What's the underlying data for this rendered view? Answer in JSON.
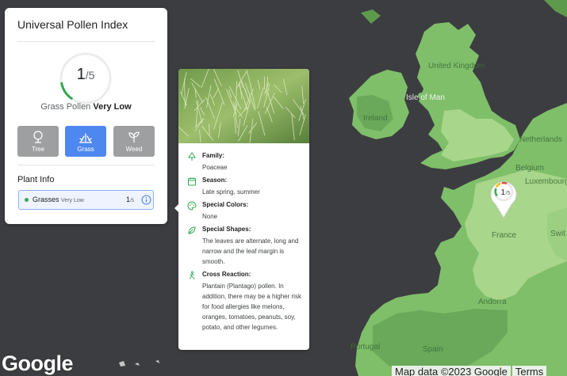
{
  "panel": {
    "title": "Universal Pollen Index",
    "index_value": "1",
    "index_denominator": "/5",
    "index_fraction": 0.2,
    "pollen_type_label": "Grass Pollen",
    "pollen_level": "Very Low",
    "type_buttons": [
      {
        "label": "Tree",
        "icon": "tree-icon",
        "active": false
      },
      {
        "label": "Grass",
        "icon": "grass-icon",
        "active": true
      },
      {
        "label": "Weed",
        "icon": "weed-icon",
        "active": false
      }
    ],
    "plant_info_title": "Plant Info",
    "plant_row": {
      "name": "Grasses",
      "level": "Very Low",
      "value": "1",
      "denominator": "/5",
      "status_color": "#34a853"
    }
  },
  "card": {
    "facts": [
      {
        "title": "Family:",
        "text": "Poaceae",
        "icon": "tree-outline-icon"
      },
      {
        "title": "Season:",
        "text": "Late spring, summer",
        "icon": "calendar-icon"
      },
      {
        "title": "Special Colors:",
        "text": "None",
        "icon": "palette-icon"
      },
      {
        "title": "Special Shapes:",
        "text": "The leaves are alternate, long and narrow and the leaf margin is smooth.",
        "icon": "leaf-icon"
      },
      {
        "title": "Cross Reaction:",
        "text": "Plantain (Plantago) pollen. In addition, there may be a higher risk for food allergies like melons, oranges, tomatoes, peanuts, soy, potato, and other legumes.",
        "icon": "cross-reaction-icon"
      }
    ]
  },
  "map": {
    "labels": [
      "United Kingdom",
      "Isle of Man",
      "Ireland",
      "Netherlands",
      "Belgium",
      "Luxembourg",
      "France",
      "Andorra",
      "Portugal",
      "Spain",
      "Swit"
    ],
    "marker": {
      "value": "1",
      "denominator": "/5"
    },
    "google_logo": "Google",
    "footer": [
      "Map data ©2023 Google",
      "Terms"
    ],
    "colors": {
      "water": "#3c3d40",
      "land_low": "#7fbf6a",
      "land_light": "#a8d68a",
      "accent": "#4f87f0"
    }
  }
}
